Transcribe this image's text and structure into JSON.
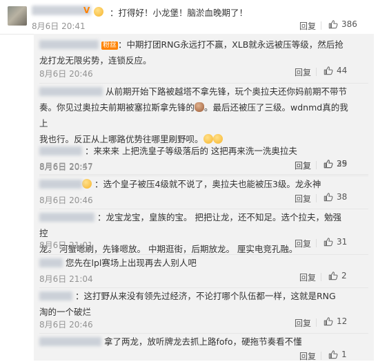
{
  "top_comment": {
    "badge_letter": "V",
    "badge_color": "#ff8200",
    "text": "：打得好！小龙堡！脑淤血晚期了！",
    "time": "8月6日 20:41",
    "reply_label": "回复",
    "likes": "386"
  },
  "replies": [
    {
      "has_badge": true,
      "badge_text": "粉丝",
      "lines": [
        "：中期打团RNG永远打不赢，XLB就永远被压等级，然后抢",
        "龙打龙无限劣势，连锁反应。"
      ],
      "time": "8月6日 20:46",
      "reply_label": "回复",
      "likes": "44"
    },
    {
      "lines": [
        "从前期开始下路被越塔不拿先锋，玩个奥拉夫还你妈前期不带节",
        "奏。你见过奥拉夫前期被塞拉斯拿先锋的",
        "。最后还被压了三级。wdnmd真的我上",
        "我也行。反正从上哪路优势往哪里刷野呗。"
      ],
      "time": "8月6日 20:47",
      "reply_label": "回复",
      "likes": "29"
    },
    {
      "lines": [
        "：来来来 上把洗皇子等级落后的 这把再来洗一洗奥拉夫"
      ],
      "time": "8月6日 20:57",
      "reply_label": "回复",
      "likes": "35"
    },
    {
      "lines": [
        "：选个皇子被压4级就不说了，奥拉夫也能被压3级。龙永神"
      ],
      "time": "8月6日 20:46",
      "reply_label": "回复",
      "likes": "38"
    },
    {
      "lines": [
        "：龙宝龙宝，皇族的宝。 把把让龙，还不知足。选个拉夫，勉强控",
        "龙。 河蟹嗯刷，先锋嗯放。 中期逛街，后期放龙。 厘实电竞孔融。"
      ],
      "time": "8月6日 21:01",
      "reply_label": "回复",
      "likes": "31"
    },
    {
      "lines": [
        "您先在lpl赛场上出现再去人别人吧"
      ],
      "time": "8月6日 21:04",
      "reply_label": "回复",
      "likes": "2"
    },
    {
      "lines": [
        "：这打野从来没有领先过经济，不论打哪个队伍都一样，这就是RNG",
        "淘的一个破烂"
      ],
      "time": "8月6日 20:46",
      "reply_label": "回复",
      "likes": "12"
    },
    {
      "lines": [
        "拿了两龙，放听牌龙去抓上路fofo，硬拖节奏看不懂"
      ],
      "time": "",
      "reply_label": "回复",
      "likes": "1"
    }
  ],
  "icons": {
    "like": "thumbs-up-icon",
    "avatar": "avatar"
  },
  "colors": {
    "panel_bg": "#f2f2f2",
    "time": "#939393",
    "badge": "#ff8200"
  }
}
